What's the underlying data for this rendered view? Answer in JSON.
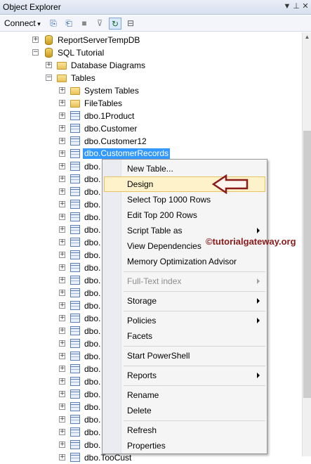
{
  "window": {
    "title": "Object Explorer"
  },
  "toolbar": {
    "connect_label": "Connect"
  },
  "tree": {
    "report_db": "ReportServerTempDB",
    "sql_tutorial": "SQL Tutorial",
    "database_diagrams": "Database Diagrams",
    "tables": "Tables",
    "system_tables": "System Tables",
    "file_tables": "FileTables",
    "t_1product": "dbo.1Product",
    "t_customer": "dbo.Customer",
    "t_customer12": "dbo.Customer12",
    "t_customer_records": "dbo.CustomerRecords",
    "dbo_partial": "dbo.",
    "dbo_cut": "dbo.TooCust"
  },
  "menu": {
    "new_table": "New Table...",
    "design": "Design",
    "select_top": "Select Top 1000 Rows",
    "edit_top": "Edit Top 200 Rows",
    "script_table": "Script Table as",
    "view_deps": "View Dependencies",
    "memory_opt": "Memory Optimization Advisor",
    "full_text": "Full-Text index",
    "storage": "Storage",
    "policies": "Policies",
    "facets": "Facets",
    "powershell": "Start PowerShell",
    "reports": "Reports",
    "rename": "Rename",
    "delete": "Delete",
    "refresh": "Refresh",
    "properties": "Properties"
  },
  "watermark": "©tutorialgateway.org",
  "icons": [
    "pin-icon",
    "close-icon",
    "connect-icon",
    "disconnect-icon",
    "stop-icon",
    "filter-icon",
    "refresh-icon",
    "collapse-icon",
    "database-icon",
    "folder-icon",
    "table-icon",
    "submenu-arrow-icon"
  ],
  "colors": {
    "selection": "#3399ff",
    "menu_highlight": "#fdf2c9",
    "arrow": "#8b1a1a",
    "watermark": "#8b1a1a"
  }
}
